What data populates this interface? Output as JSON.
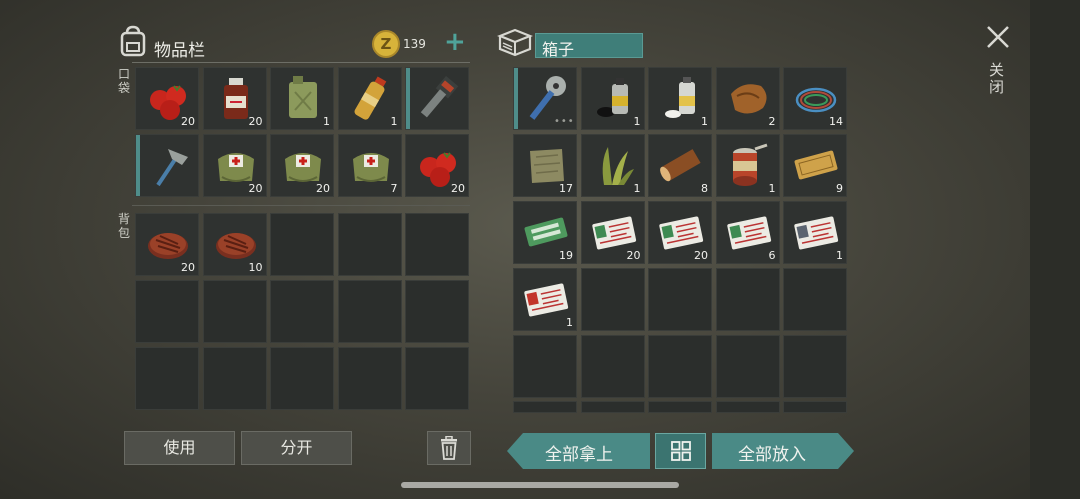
{
  "inventory": {
    "title": "物品栏",
    "coins": "139",
    "pocket_label": "口袋",
    "backpack_label": "背包",
    "pocket_items": [
      {
        "icon": "tomato-icon",
        "qty": "20"
      },
      {
        "icon": "medicine-bottle-icon",
        "qty": "20"
      },
      {
        "icon": "jerrycan-icon",
        "qty": "1"
      },
      {
        "icon": "water-bottle-icon",
        "qty": "1"
      },
      {
        "icon": "chainsaw-icon",
        "qty": ""
      },
      {
        "icon": "hatchet-icon",
        "qty": ""
      },
      {
        "icon": "first-aid-bag-icon",
        "qty": "20"
      },
      {
        "icon": "first-aid-bag-icon",
        "qty": "20"
      },
      {
        "icon": "first-aid-bag-icon",
        "qty": "7"
      },
      {
        "icon": "tomato-icon",
        "qty": "20"
      }
    ],
    "backpack_items": [
      {
        "icon": "steak-icon",
        "qty": "20"
      },
      {
        "icon": "steak-icon",
        "qty": "10"
      }
    ]
  },
  "box": {
    "title": "箱子",
    "items": [
      {
        "icon": "saw-tool-icon",
        "qty": ""
      },
      {
        "icon": "spray-paint-icon",
        "qty": "1"
      },
      {
        "icon": "spray-can-icon",
        "qty": "1"
      },
      {
        "icon": "leather-scraps-icon",
        "qty": "2"
      },
      {
        "icon": "wire-coil-icon",
        "qty": "14"
      },
      {
        "icon": "cloth-icon",
        "qty": "17"
      },
      {
        "icon": "plant-fiber-icon",
        "qty": "1"
      },
      {
        "icon": "log-icon",
        "qty": "8"
      },
      {
        "icon": "tin-can-icon",
        "qty": "1"
      },
      {
        "icon": "coupon-ticket-icon",
        "qty": "9"
      },
      {
        "icon": "ration-coupon-icon",
        "qty": "19"
      },
      {
        "icon": "army-card-a-icon",
        "qty": "20"
      },
      {
        "icon": "army-card-a-icon",
        "qty": "20"
      },
      {
        "icon": "army-card-a-icon",
        "qty": "6"
      },
      {
        "icon": "army-card-d-icon",
        "qty": "1"
      },
      {
        "icon": "army-card-z-icon",
        "qty": "1"
      }
    ]
  },
  "buttons": {
    "use": "使用",
    "split": "分开",
    "take_all": "全部拿上",
    "put_all": "全部放入"
  },
  "close_label": "关闭",
  "colors": {
    "accent": "#4a8a86",
    "coin": "#d7b33a"
  }
}
